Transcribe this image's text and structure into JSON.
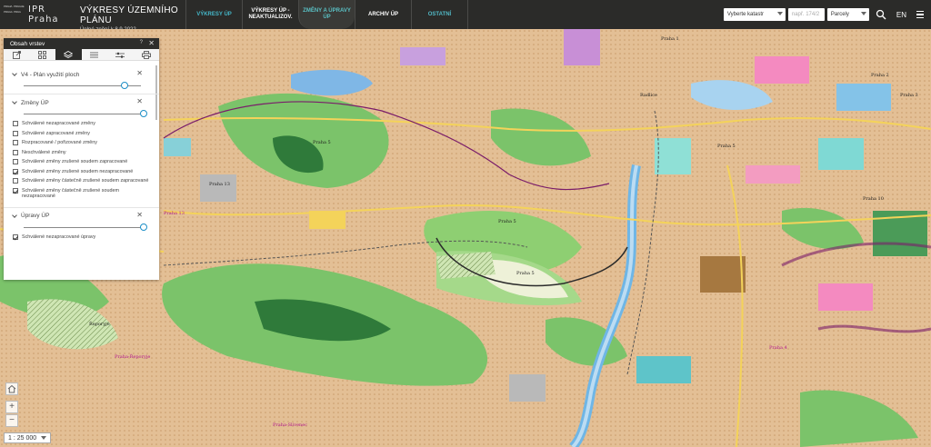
{
  "header": {
    "logo_cells": [
      "PRAHA",
      "PRAGUE",
      "PRAGA",
      "PRAG"
    ],
    "logo_brand_1": "IPR",
    "logo_brand_2": "Praha",
    "app_title": "VÝKRESY ÚZEMNÍHO PLÁNU",
    "app_subtitle": "Úplné znění k 8.9.2022",
    "nav": {
      "vykresy_up": "VÝKRESY ÚP",
      "vykresy_neaktual": "VÝKRESY ÚP - NEAKTUALIZOV.",
      "zmeny_upravy": "ZMĚNY A ÚPRAVY ÚP",
      "archiv": "ARCHIV ÚP",
      "ostatni": "OSTATNÍ"
    },
    "cadastre_select": "Vyberte katastr",
    "parcel_placeholder": "např. 174/2",
    "type_select": "Parcely",
    "lang": "EN",
    "search_icon": "search-icon",
    "menu_icon": "hamburger-menu-icon"
  },
  "panel": {
    "title": "Obsah vrstev",
    "help": "?",
    "close": "✕",
    "tabs": [
      "export-icon",
      "grid-icon",
      "layers-icon",
      "list-icon",
      "settings-sliders-icon",
      "print-icon"
    ],
    "active_tab": 2,
    "sections": [
      {
        "title": "V4 - Plán využití ploch",
        "slider_value": 0.84
      },
      {
        "title": "Změny ÚP",
        "slider_value": 1.0,
        "items": [
          {
            "label": "Schválené nezapracované změny",
            "checked": false
          },
          {
            "label": "Schválené zapracované změny",
            "checked": false
          },
          {
            "label": "Rozpracované / pořizované změny",
            "checked": false
          },
          {
            "label": "Neschválené změny",
            "checked": false
          },
          {
            "label": "Schválené změny zrušené soudem zapracované",
            "checked": false
          },
          {
            "label": "Schválené změny zrušené soudem nezapracované",
            "checked": true
          },
          {
            "label": "Schválené změny částečně zrušené soudem zapracované",
            "checked": false
          },
          {
            "label": "Schválené změny částečně zrušené soudem nezapracované",
            "checked": true
          }
        ]
      },
      {
        "title": "Úpravy ÚP",
        "slider_value": 1.0,
        "items": [
          {
            "label": "Schválené nezapracované úpravy",
            "checked": true
          }
        ]
      }
    ]
  },
  "map": {
    "labels": {
      "praha1": "Praha 1",
      "praha2": "Praha 2",
      "praha3": "Praha 3",
      "praha4": "Praha 4",
      "praha5a": "Praha 5",
      "praha5b": "Praha 5",
      "praha5c": "Praha 5",
      "praha5d": "Praha 5",
      "praha10": "Praha 10",
      "praha13": "Praha 13",
      "praha13b": "Praha 13",
      "praha_reporyje": "Praha-Řeporyje",
      "praha_slivenec": "Praha-Slivenec",
      "reporyje": "Řeporyje",
      "radlice": "Radlice"
    },
    "zoom_in": "+",
    "zoom_out": "−",
    "home_icon": "home-icon",
    "scale": "1 : 25 000"
  },
  "colors": {
    "header_bg": "#2b2b29",
    "accent_teal": "#45b7c9",
    "map_base": "#e9c9a3",
    "forest": "#7bc36a",
    "water": "#7fb7e6"
  }
}
